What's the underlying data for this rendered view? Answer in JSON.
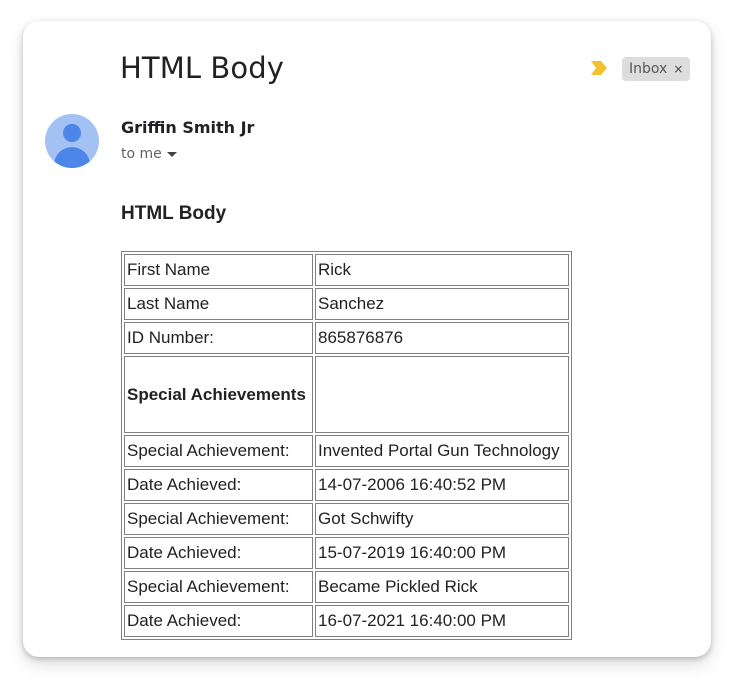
{
  "email": {
    "subject": "HTML Body",
    "label": "Inbox",
    "label_close": "×",
    "sender_name": "Griffin Smith Jr",
    "recipient_text": "to me",
    "body_heading": "HTML Body"
  },
  "icons": {
    "importance": "importance-marker-icon",
    "avatar": "person-avatar-icon",
    "caret": "caret-down-icon"
  },
  "colors": {
    "importance_marker": "#f2c132",
    "avatar_bg": "#a4c1f4",
    "avatar_fg": "#4c86e8",
    "label_chip_bg": "#dddddd"
  },
  "table": {
    "rows": [
      {
        "label": "First Name",
        "value": "Rick"
      },
      {
        "label": "Last Name",
        "value": "Sanchez"
      },
      {
        "label": "ID Number:",
        "value": "865876876"
      },
      {
        "label": "Special Achievements",
        "value": ""
      },
      {
        "label": "Special Achievement:",
        "value": "Invented Portal Gun Technology"
      },
      {
        "label": "Date Achieved:",
        "value": "14-07-2006 16:40:52 PM"
      },
      {
        "label": "Special Achievement:",
        "value": "Got Schwifty"
      },
      {
        "label": "Date Achieved:",
        "value": "15-07-2019 16:40:00 PM"
      },
      {
        "label": "Special Achievement:",
        "value": "Became Pickled Rick"
      },
      {
        "label": "Date Achieved:",
        "value": "16-07-2021 16:40:00 PM"
      }
    ]
  }
}
